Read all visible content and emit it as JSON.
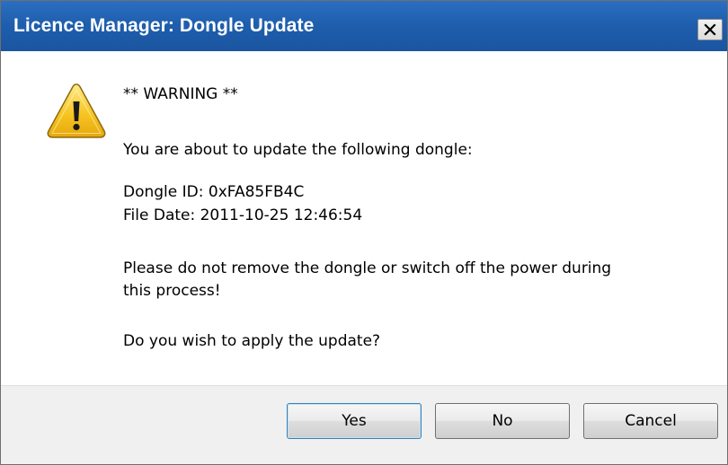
{
  "window": {
    "title": "Licence Manager: Dongle Update",
    "close_glyph": "X"
  },
  "message": {
    "heading": "** WARNING **",
    "intro": "You are about to update the following dongle:",
    "dongle_id": "Dongle ID: 0xFA85FB4C",
    "file_date": "File Date: 2011-10-25 12:46:54",
    "caution_line1": "Please do not remove the dongle or switch off the power during",
    "caution_line2": "this process!",
    "question": "Do you wish to apply the update?"
  },
  "buttons": {
    "yes": "Yes",
    "no": "No",
    "cancel": "Cancel"
  },
  "icons": {
    "warning": "warning-icon",
    "close": "close-icon"
  },
  "colors": {
    "titlebar": "#1f5fae",
    "warning_fill": "#f7c623",
    "footer": "#f0f0f0"
  }
}
